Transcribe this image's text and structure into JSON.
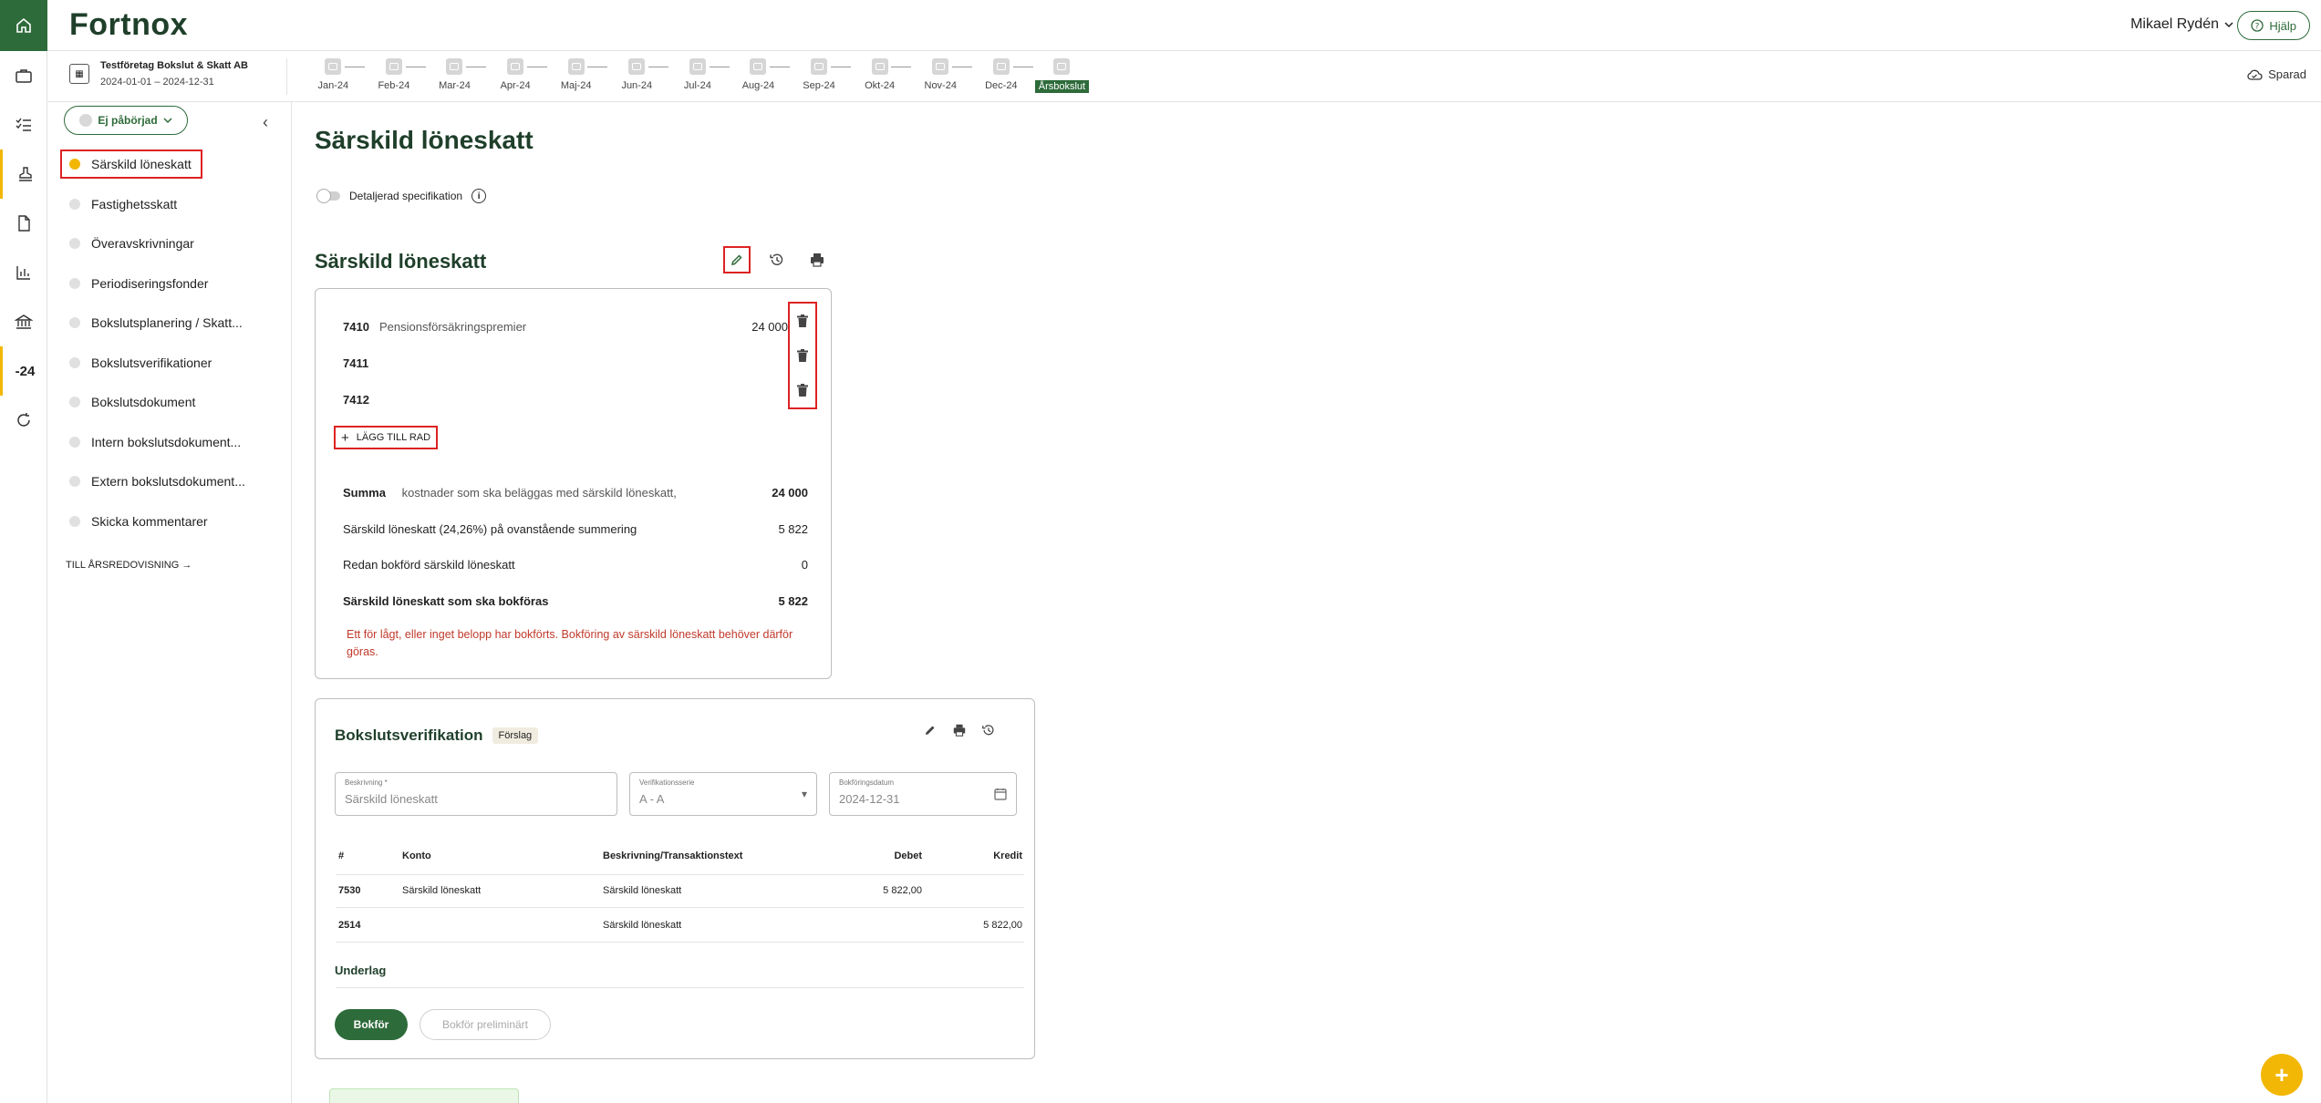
{
  "app": {
    "logo": "Fortnox",
    "user_name": "Mikael Rydén",
    "help_label": "Hjälp",
    "saved_label": "Sparad",
    "rail_period_label": "-24"
  },
  "company": {
    "name": "Testföretag Bokslut & Skatt AB",
    "period": "2024-01-01 – 2024-12-31"
  },
  "months": [
    "Jan-24",
    "Feb-24",
    "Mar-24",
    "Apr-24",
    "Maj-24",
    "Jun-24",
    "Jul-24",
    "Aug-24",
    "Sep-24",
    "Okt-24",
    "Nov-24",
    "Dec-24",
    "Årsbokslut"
  ],
  "active_month": "Årsbokslut",
  "sidebar": {
    "status": "Ej påbörjad",
    "items": [
      "Särskild löneskatt",
      "Fastighetsskatt",
      "Överavskrivningar",
      "Periodiseringsfonder",
      "Bokslutsplanering / Skatt...",
      "Bokslutsverifikationer",
      "Bokslutsdokument",
      "Intern bokslutsdokument...",
      "Extern bokslutsdokument...",
      "Skicka kommentarer"
    ],
    "to_annual": "TILL ÅRSREDOVISNING"
  },
  "main": {
    "page_title": "Särskild löneskatt",
    "toggle_label": "Detaljerad specifikation",
    "section_title": "Särskild löneskatt",
    "accounts": [
      {
        "number": "7410",
        "name": "Pensionsförsäkringspremier",
        "amount": "24 000"
      },
      {
        "number": "7411",
        "name": "",
        "amount": ""
      },
      {
        "number": "7412",
        "name": "",
        "amount": ""
      }
    ],
    "add_row_label": "LÄGG TILL RAD",
    "summary": {
      "sum_label": "Summa",
      "sum_desc": "kostnader som ska beläggas med särskild löneskatt,",
      "sum_value": "24 000",
      "tax_label": "Särskild löneskatt (24,26%) på ovanstående summering",
      "tax_value": "5 822",
      "booked_label": "Redan bokförd särskild löneskatt",
      "booked_value": "0",
      "to_book_label": "Särskild löneskatt som ska bokföras",
      "to_book_value": "5 822"
    },
    "warning": "Ett för lågt, eller inget belopp har bokförts. Bokföring av särskild löneskatt behöver därför göras."
  },
  "verification": {
    "title": "Bokslutsverifikation",
    "badge": "Förslag",
    "description_label": "Beskrivning *",
    "description_value": "Särskild löneskatt",
    "series_label": "Verifikationsserie",
    "series_value": "A - A",
    "date_label": "Bokföringsdatum",
    "date_value": "2024-12-31",
    "columns": {
      "num": "#",
      "account": "Konto",
      "desc": "Beskrivning/Transaktionstext",
      "debit": "Debet",
      "credit": "Kredit"
    },
    "rows": [
      {
        "num": "7530",
        "account": "Särskild löneskatt",
        "desc": "Särskild löneskatt",
        "debit": "5 822,00",
        "credit": ""
      },
      {
        "num": "2514",
        "account": "",
        "desc": "Särskild löneskatt",
        "debit": "",
        "credit": "5 822,00"
      }
    ],
    "underlag_label": "Underlag",
    "book_button": "Bokför",
    "prelim_button": "Bokför preliminärt"
  },
  "colors": {
    "brand_green": "#2e6b3a",
    "accent_yellow": "#f2b705",
    "highlight_red": "#dd2222",
    "warning_red": "#c0392b"
  }
}
